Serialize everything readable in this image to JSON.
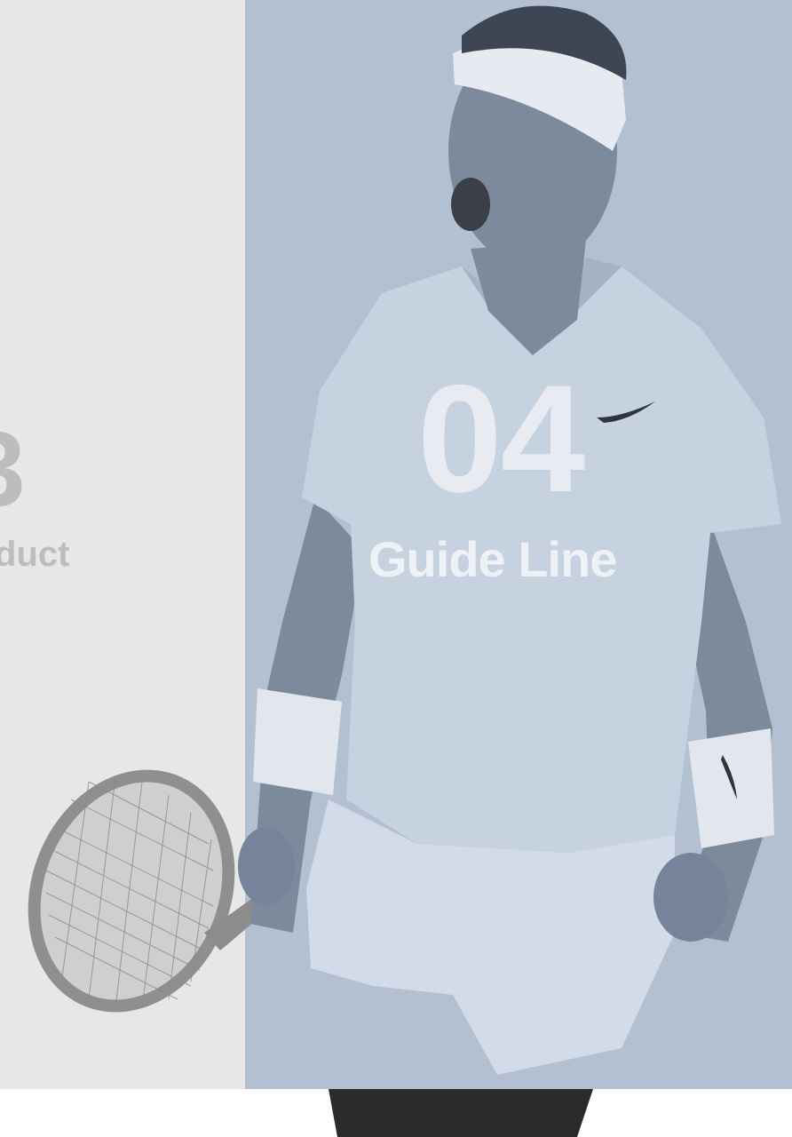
{
  "left_section": {
    "number": "3",
    "label": "duct"
  },
  "right_section": {
    "number": "04",
    "title": "Guide Line"
  },
  "colors": {
    "left_panel_bg": "#e7e7e7",
    "right_panel_bg": "#b2c0d2",
    "left_text": "#bdbdbd",
    "title_text": "#eef1f6"
  },
  "image": {
    "subject": "tennis-player-photo"
  }
}
